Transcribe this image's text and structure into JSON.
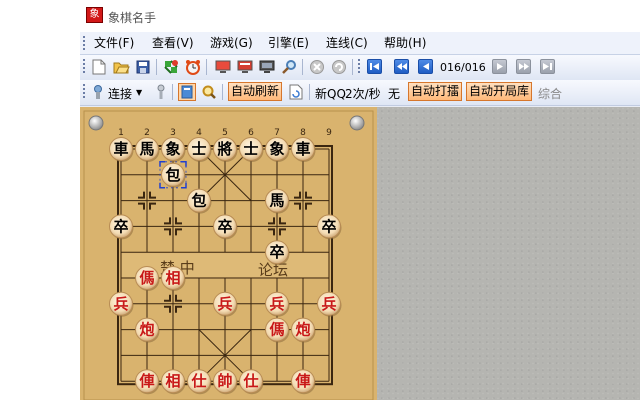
{
  "window": {
    "title": "象棋名手",
    "icon_char": "象"
  },
  "menu": [
    {
      "id": "file",
      "label": "文件(F)"
    },
    {
      "id": "view",
      "label": "查看(V)"
    },
    {
      "id": "game",
      "label": "游戏(G)"
    },
    {
      "id": "engine",
      "label": "引擎(E)"
    },
    {
      "id": "connect",
      "label": "连线(C)"
    },
    {
      "id": "help",
      "label": "帮助(H)"
    }
  ],
  "toolbar1": {
    "icons": [
      "new-file-icon",
      "open-folder-icon",
      "save-disk-icon",
      "engine-puzzle-icon",
      "alarm-clock-icon",
      "board-red-icon",
      "board-red-2-icon",
      "monitor-icon",
      "search-magnifier-icon",
      "stop-icon",
      "undo-icon"
    ],
    "navigation": [
      "first-move-icon",
      "prev-fast-icon",
      "prev-move-icon",
      "next-move-icon",
      "next-fast-icon",
      "last-move-icon"
    ],
    "move_counter": "016/016"
  },
  "toolbar2": {
    "connect_label": "连接",
    "auto_refresh": "自动刷新",
    "source_text": "新QQ",
    "speed_text": "2次/秒",
    "none_text": "无",
    "auto_play": "自动打擂",
    "auto_book": "自动开局库",
    "composite": "综合"
  },
  "board": {
    "file_numbers": [
      "1",
      "2",
      "3",
      "4",
      "5",
      "6",
      "7",
      "8",
      "9"
    ],
    "river_text_left": "楚 中",
    "river_text_right": "论坛",
    "last_move_highlight": "selection-frame",
    "pieces": [
      {
        "side": "black",
        "char": "車",
        "file": 1,
        "rank": 1
      },
      {
        "side": "black",
        "char": "馬",
        "file": 2,
        "rank": 1
      },
      {
        "side": "black",
        "char": "象",
        "file": 3,
        "rank": 1
      },
      {
        "side": "black",
        "char": "士",
        "file": 4,
        "rank": 1
      },
      {
        "side": "black",
        "char": "將",
        "file": 5,
        "rank": 1
      },
      {
        "side": "black",
        "char": "士",
        "file": 6,
        "rank": 1
      },
      {
        "side": "black",
        "char": "象",
        "file": 7,
        "rank": 1
      },
      {
        "side": "black",
        "char": "車",
        "file": 8,
        "rank": 1
      },
      {
        "side": "black",
        "char": "包",
        "file": 3,
        "rank": 2
      },
      {
        "side": "black",
        "char": "包",
        "file": 4,
        "rank": 3
      },
      {
        "side": "black",
        "char": "馬",
        "file": 7,
        "rank": 3
      },
      {
        "side": "black",
        "char": "卒",
        "file": 1,
        "rank": 4
      },
      {
        "side": "black",
        "char": "卒",
        "file": 5,
        "rank": 4
      },
      {
        "side": "black",
        "char": "卒",
        "file": 9,
        "rank": 4
      },
      {
        "side": "black",
        "char": "卒",
        "file": 7,
        "rank": 5
      },
      {
        "side": "red",
        "char": "傌",
        "file": 2,
        "rank": 6
      },
      {
        "side": "red",
        "char": "相",
        "file": 3,
        "rank": 6
      },
      {
        "side": "red",
        "char": "兵",
        "file": 1,
        "rank": 7
      },
      {
        "side": "red",
        "char": "兵",
        "file": 5,
        "rank": 7
      },
      {
        "side": "red",
        "char": "兵",
        "file": 7,
        "rank": 7
      },
      {
        "side": "red",
        "char": "兵",
        "file": 9,
        "rank": 7
      },
      {
        "side": "red",
        "char": "炮",
        "file": 2,
        "rank": 8
      },
      {
        "side": "red",
        "char": "傌",
        "file": 7,
        "rank": 8
      },
      {
        "side": "red",
        "char": "炮",
        "file": 8,
        "rank": 8
      },
      {
        "side": "red",
        "char": "俥",
        "file": 2,
        "rank": 10
      },
      {
        "side": "red",
        "char": "相",
        "file": 3,
        "rank": 10
      },
      {
        "side": "red",
        "char": "仕",
        "file": 4,
        "rank": 10
      },
      {
        "side": "red",
        "char": "帥",
        "file": 5,
        "rank": 10
      },
      {
        "side": "red",
        "char": "仕",
        "file": 6,
        "rank": 10
      },
      {
        "side": "red",
        "char": "俥",
        "file": 8,
        "rank": 10
      }
    ],
    "selection": {
      "file": 3,
      "rank": 2
    }
  },
  "colors": {
    "red_piece": "#c81818",
    "black_piece": "#000000",
    "board": "#d9b36e",
    "accent_button": "#ffb97a"
  }
}
